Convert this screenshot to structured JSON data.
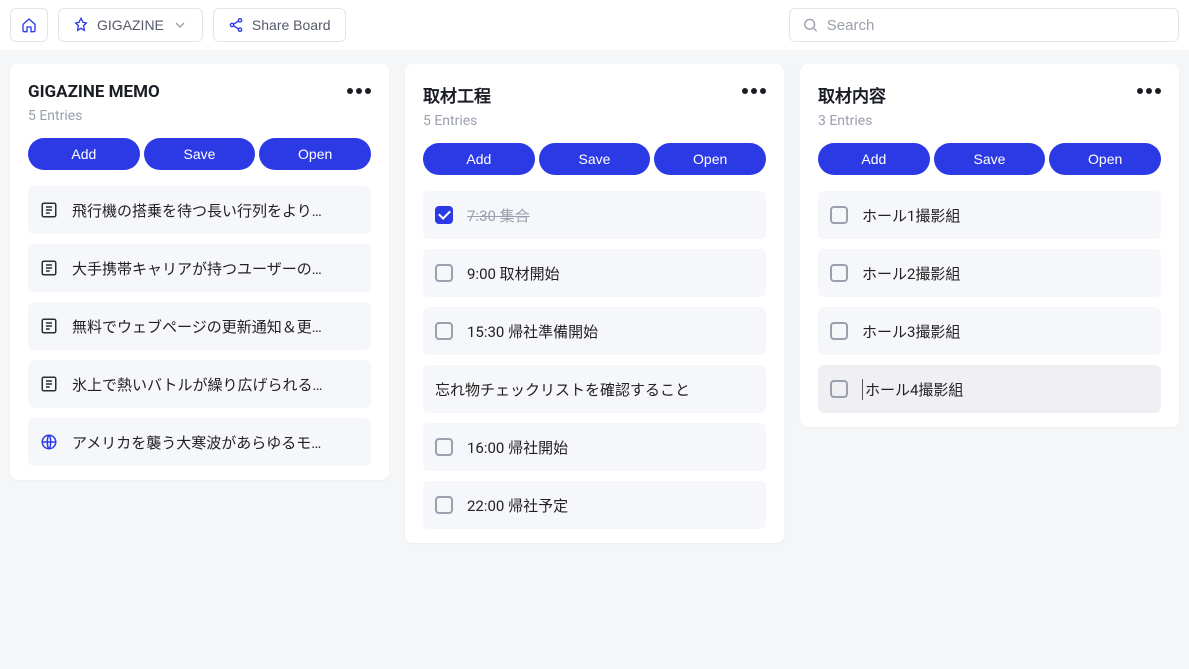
{
  "topbar": {
    "board_label": "GIGAZINE",
    "share_label": "Share Board",
    "search_placeholder": "Search"
  },
  "buttons": {
    "add": "Add",
    "save": "Save",
    "open": "Open"
  },
  "cards": [
    {
      "title": "GIGAZINE MEMO",
      "entries_label": "5 Entries",
      "items": [
        {
          "kind": "doc",
          "text": "飛行機の搭乗を待つ長い行列をより…"
        },
        {
          "kind": "doc",
          "text": "大手携帯キャリアが持つユーザーの…"
        },
        {
          "kind": "doc",
          "text": "無料でウェブページの更新通知＆更…"
        },
        {
          "kind": "doc",
          "text": "氷上で熱いバトルが繰り広げられる…"
        },
        {
          "kind": "globe",
          "text": "アメリカを襲う大寒波があらゆるモ…"
        }
      ]
    },
    {
      "title": "取材工程",
      "entries_label": "5 Entries",
      "items": [
        {
          "kind": "check",
          "checked": true,
          "text": "7:30 集合"
        },
        {
          "kind": "check",
          "checked": false,
          "text": "9:00 取材開始"
        },
        {
          "kind": "check",
          "checked": false,
          "text": "15:30 帰社準備開始"
        },
        {
          "kind": "plain",
          "text": "忘れ物チェックリストを確認すること"
        },
        {
          "kind": "check",
          "checked": false,
          "text": "16:00 帰社開始"
        },
        {
          "kind": "check",
          "checked": false,
          "text": "22:00 帰社予定"
        }
      ]
    },
    {
      "title": "取材内容",
      "entries_label": "3 Entries",
      "items": [
        {
          "kind": "check",
          "checked": false,
          "text": "ホール1撮影組"
        },
        {
          "kind": "check",
          "checked": false,
          "text": "ホール2撮影組"
        },
        {
          "kind": "check",
          "checked": false,
          "text": "ホール3撮影組"
        },
        {
          "kind": "check",
          "checked": false,
          "text": "ホール4撮影組",
          "editing": true
        }
      ]
    }
  ]
}
